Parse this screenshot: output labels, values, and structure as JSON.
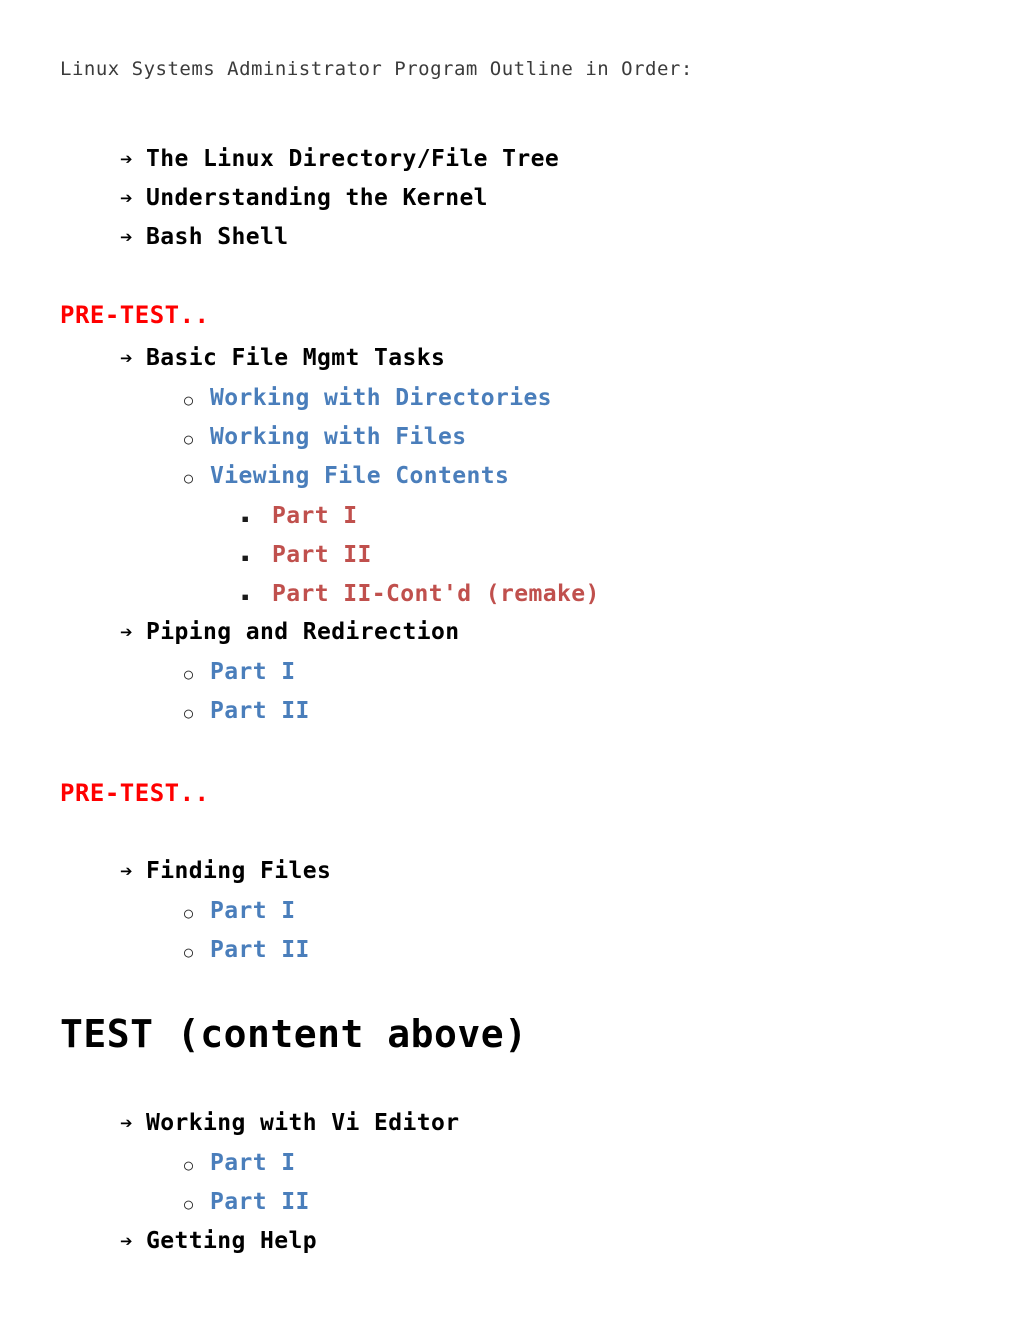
{
  "document": {
    "title": "Linux Systems Administrator Program Outline in Order:"
  },
  "bullets": {
    "arrow": "➔",
    "circle": "○",
    "square": "▪"
  },
  "colors": {
    "title": "#3b3b3b",
    "level1": "#000000",
    "level2_blue": "#4a7ebb",
    "level3_red": "#c0504d",
    "pretest_red": "#ff0000",
    "background": "#ffffff"
  },
  "headings": {
    "pretest_1": "PRE-TEST..",
    "pretest_2": "PRE-TEST..",
    "test": "TEST (content above)"
  },
  "outline": {
    "group1": [
      {
        "label": "The Linux Directory/File Tree"
      },
      {
        "label": "Understanding the Kernel"
      },
      {
        "label": "Bash Shell"
      }
    ],
    "group2": {
      "basic_file_mgmt": "Basic File Mgmt Tasks",
      "sub": [
        {
          "label": "Working with Directories"
        },
        {
          "label": "Working with Files"
        },
        {
          "label": "Viewing File Contents"
        }
      ],
      "viewing_parts": [
        {
          "label": "Part I"
        },
        {
          "label": "Part II"
        },
        {
          "label": "Part II-Cont'd (remake)"
        }
      ],
      "piping": "Piping and Redirection",
      "piping_parts": [
        {
          "label": "Part I"
        },
        {
          "label": "Part II"
        }
      ]
    },
    "group3": {
      "finding_files": "Finding Files",
      "finding_parts": [
        {
          "label": "Part I"
        },
        {
          "label": "Part II"
        }
      ]
    },
    "group4": {
      "vi_editor": "Working with Vi Editor",
      "vi_parts": [
        {
          "label": "Part I"
        },
        {
          "label": "Part II"
        }
      ],
      "getting_help": "Getting Help"
    }
  }
}
